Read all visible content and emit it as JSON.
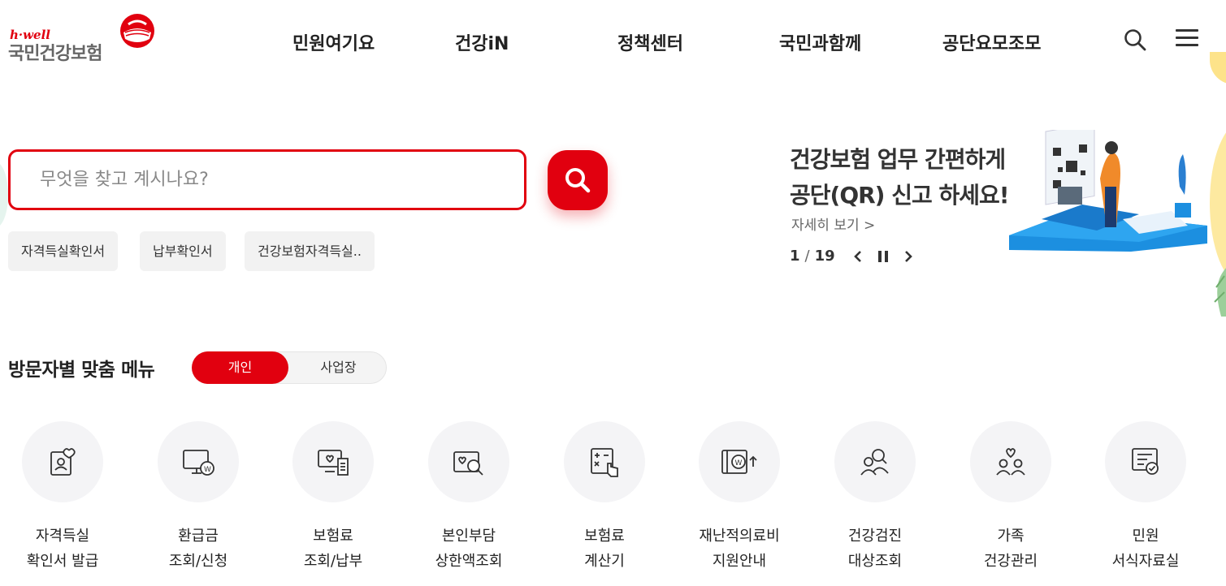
{
  "logo": {
    "tagline": "h·well",
    "name": "국민건강보험"
  },
  "gnb": {
    "items": [
      "민원여기요",
      "건강iN",
      "정책센터",
      "국민과함께",
      "공단요모조모"
    ]
  },
  "search": {
    "placeholder": "무엇을 찾고 계시나요?",
    "chips": [
      "자격득실확인서",
      "납부확인서",
      "건강보험자격득실.."
    ]
  },
  "banner": {
    "title_line1": "건강보험 업무 간편하게",
    "title_line2": "공단(QR) 신고 하세요!",
    "more": "자세히 보기 >",
    "page_current": "1",
    "page_total": "19"
  },
  "visitor_menu": {
    "title": "방문자별 맞춤 메뉴",
    "tabs": [
      "개인",
      "사업장"
    ],
    "active_tab": "개인",
    "services": [
      {
        "line1": "자격득실",
        "line2": "확인서 발급",
        "icon": "id-card-heart-icon"
      },
      {
        "line1": "환급금",
        "line2": "조회/신청",
        "icon": "monitor-won-icon"
      },
      {
        "line1": "보험료",
        "line2": "조회/납부",
        "icon": "monitor-receipt-icon"
      },
      {
        "line1": "본인부담",
        "line2": "상한액조회",
        "icon": "card-search-icon"
      },
      {
        "line1": "보험료",
        "line2": "계산기",
        "icon": "calculator-icon"
      },
      {
        "line1": "재난적의료비",
        "line2": "지원안내",
        "icon": "wallet-won-icon"
      },
      {
        "line1": "건강검진",
        "line2": "대상조회",
        "icon": "people-search-icon"
      },
      {
        "line1": "가족",
        "line2": "건강관리",
        "icon": "family-heart-icon"
      },
      {
        "line1": "민원",
        "line2": "서식자료실",
        "icon": "document-check-icon"
      }
    ]
  },
  "colors": {
    "brand_red": "#e1000f",
    "text_dark": "#222222",
    "chip_bg": "#f2f2f2",
    "icon_circle_bg": "#f4f4f6"
  }
}
